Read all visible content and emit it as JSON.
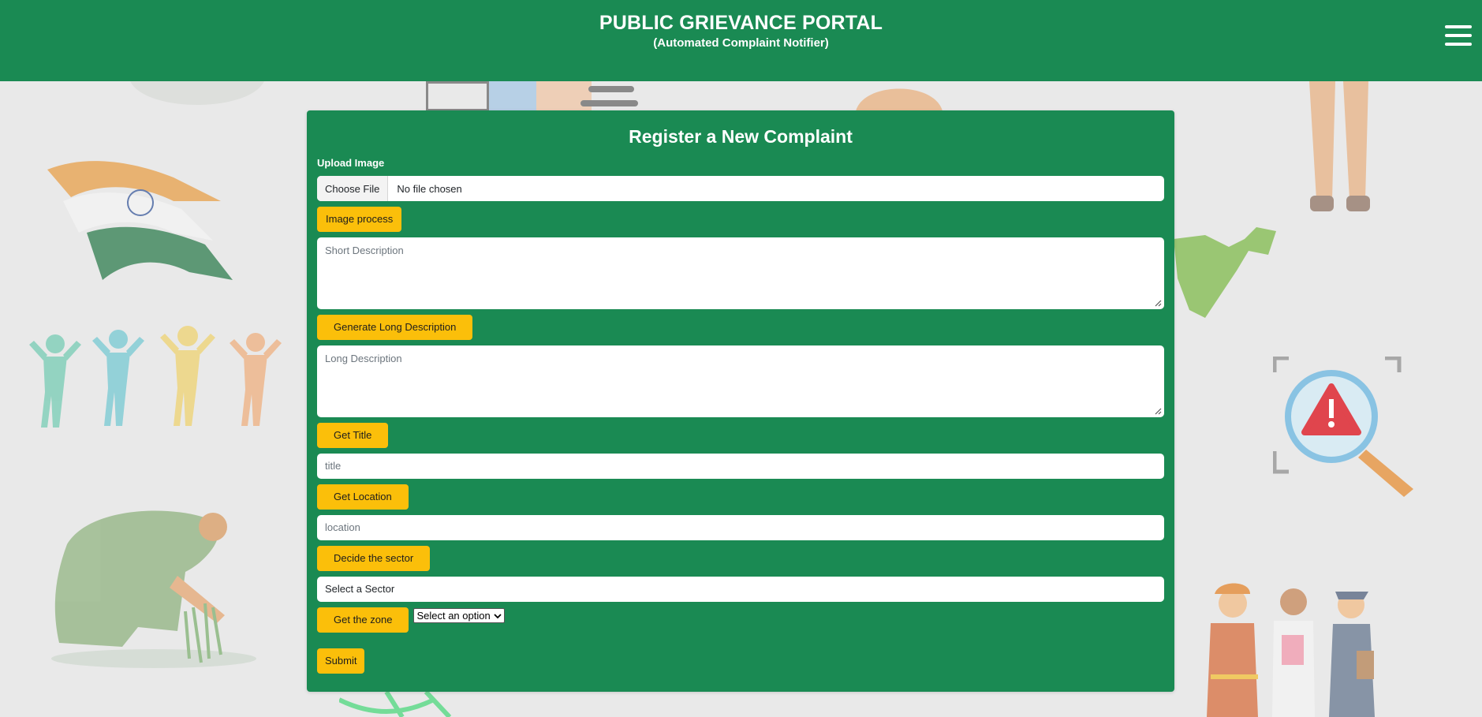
{
  "header": {
    "title": "PUBLIC GRIEVANCE PORTAL",
    "subtitle": "(Automated Complaint Notifier)",
    "menu_icon": "hamburger-menu-icon"
  },
  "form": {
    "title": "Register a New Complaint",
    "upload_label": "Upload Image",
    "file_button": "Choose File",
    "file_status": "No file chosen",
    "image_process_button": "Image process",
    "short_description_placeholder": "Short Description",
    "generate_long_button": "Generate Long Description",
    "long_description_placeholder": "Long Description",
    "get_title_button": "Get Title",
    "title_placeholder": "title",
    "get_location_button": "Get Location",
    "location_placeholder": "location",
    "decide_sector_button": "Decide the sector",
    "sector_selected": "Select a Sector",
    "get_zone_button": "Get the zone",
    "zone_selected": "Select an option",
    "submit_button": "Submit"
  },
  "colors": {
    "brand_green": "#1a8a53",
    "button_yellow": "#fbbf0a",
    "page_background": "#e9e9e9"
  }
}
